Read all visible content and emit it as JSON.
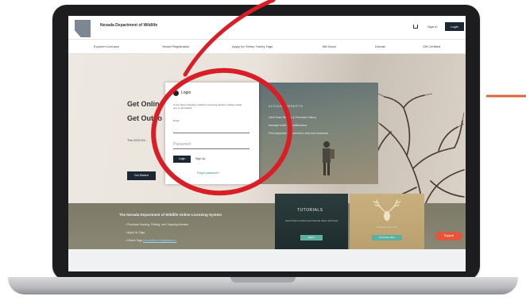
{
  "header": {
    "site_title": "Nevada Department of Wildlife",
    "sign_in": "Sign In",
    "login": "Login"
  },
  "nav": {
    "items": [
      "Explorer Licenses",
      "Vessel Registration",
      "Apply for Sheep Turkey Tags",
      "Bill Decal",
      "Donate",
      "Gift Certified"
    ]
  },
  "hero": {
    "line1": "Get Online",
    "line2": "Get Outdo",
    "subtitle": "The 2024 Eli...",
    "button": "Get Started"
  },
  "panel": {
    "heading": "ACCOUNT BENEFITS",
    "lines": [
      "View Draw Results & Purchase History",
      "Manage email and notifications",
      "Find important documents to view and download"
    ]
  },
  "modal": {
    "title": "Login",
    "description": "If you haven't already created a Licensing account, please create one to get started",
    "email_label": "Email",
    "email_value": "",
    "password_placeholder": "Password",
    "login_button": "Login",
    "signup_link": "Sign Up",
    "forgot_link": "Forgot password?"
  },
  "lower": {
    "title": "The Nevada Department of Wildlife Online Licensing System",
    "bullets": [
      "Purchase Hunting, Fishing, and Trapping licenses",
      "Apply for Tags"
    ],
    "bullet3_prefix": "Return Tags ",
    "bullet3_link": "Information & Applications ›"
  },
  "tutorial": {
    "title": "TUTORIALS",
    "text": "Learn how to submit your harvest return and more",
    "button": "Watch"
  },
  "deer_card": {
    "text": "Purchase and more",
    "button": "Purchase Now"
  },
  "support": {
    "label": "Support"
  },
  "colors": {
    "annotation_red": "#d81e26",
    "accent_orange": "#d9673a",
    "navy": "#1c2733",
    "teal": "#5bb0a0"
  }
}
